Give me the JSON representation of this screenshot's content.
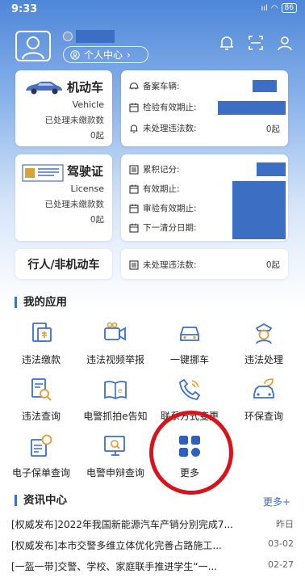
{
  "status_bar": {
    "time": "9:33",
    "battery": "86"
  },
  "header": {
    "personal_center": "个人中心"
  },
  "vehicle": {
    "title": "机动车",
    "subtitle": "Vehicle",
    "unpaid_label": "已处理未缴款数",
    "unpaid_value": "0起",
    "info": {
      "registered_label": "备案车辆:",
      "inspection_label": "检验有效期止:",
      "violations_label": "未处理违法数:",
      "violations_value": "0起"
    }
  },
  "license": {
    "title": "驾驶证",
    "subtitle": "License",
    "unpaid_label": "已处理未缴款数",
    "unpaid_value": "0起",
    "info": {
      "points_label": "累积记分:",
      "valid_label": "有效期止:",
      "review_label": "审验有效期止:",
      "clear_label": "下一清分日期:"
    }
  },
  "nonmotor": {
    "title": "行人/非机动车",
    "violations_label": "未处理违法数:",
    "violations_value": "0起"
  },
  "apps": {
    "title": "我的应用",
    "items": [
      {
        "label": "违法缴款"
      },
      {
        "label": "违法视频举报"
      },
      {
        "label": "一键挪车"
      },
      {
        "label": "违法处理"
      },
      {
        "label": "违法查询"
      },
      {
        "label": "电警抓拍e告知"
      },
      {
        "label": "联系方式变更"
      },
      {
        "label": "环保查询"
      },
      {
        "label": "电子保单查询"
      },
      {
        "label": "电警申辩查询"
      },
      {
        "label": "更多"
      }
    ]
  },
  "news": {
    "title": "资讯中心",
    "more": "更多+",
    "items": [
      {
        "tag": "[权威发布]",
        "text": "2022年我国新能源汽车产销分别完成7...",
        "date": "昨日"
      },
      {
        "tag": "[权威发布]",
        "text": "本市交警多维立体优化完善占路施工...",
        "date": "03-02"
      },
      {
        "tag": "[一盔一带]",
        "text": "交警、学校、家庭联手推进学生“一...",
        "date": "02-27"
      }
    ]
  },
  "colors": {
    "accent": "#3a6fd0",
    "mask": "#3c6fc4",
    "highlight_circle": "#d8141a"
  }
}
